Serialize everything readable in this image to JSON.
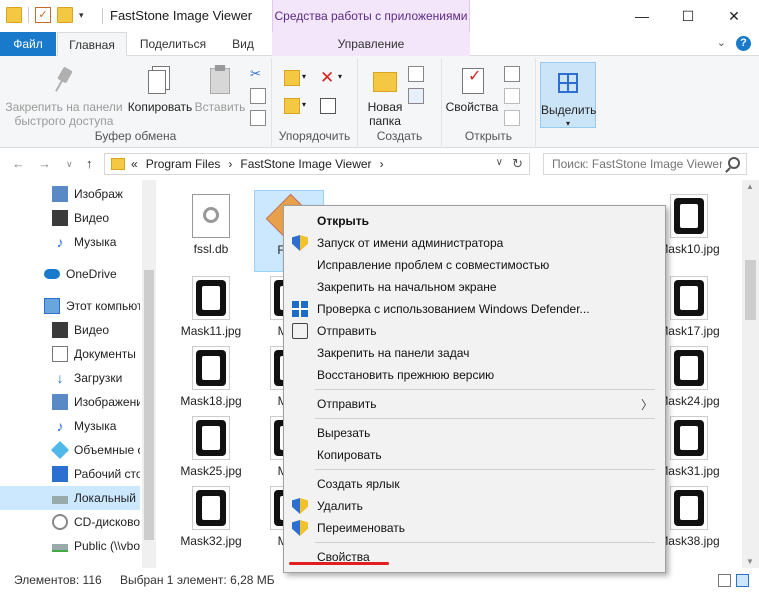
{
  "window": {
    "title": "FastStone Image Viewer",
    "context_tab_group": "Средства работы с приложениями",
    "minimize": "—",
    "maximize": "☐",
    "close": "✕"
  },
  "tabs": {
    "file": "Файл",
    "home": "Главная",
    "share": "Поделиться",
    "view": "Вид",
    "manage": "Управление",
    "collapse": "⌄"
  },
  "ribbon": {
    "clipboard": {
      "pin_label": "Закрепить на панели быстрого доступа",
      "copy_label": "Копировать",
      "paste_label": "Вставить",
      "group_label": "Буфер обмена"
    },
    "organize": {
      "group_label": "Упорядочить"
    },
    "new": {
      "new_folder_label": "Новая папка",
      "group_label": "Создать"
    },
    "open": {
      "properties_label": "Свойства",
      "group_label": "Открыть"
    },
    "select": {
      "select_label": "Выделить"
    }
  },
  "address": {
    "prefix": "«",
    "crumbs": [
      "Program Files",
      "›",
      "FastStone Image Viewer",
      "›"
    ],
    "search_placeholder": "Поиск: FastStone Image Viewer"
  },
  "nav": {
    "items": [
      {
        "label": "Изображ",
        "icon": "pictures-icon"
      },
      {
        "label": "Видео",
        "icon": "video-icon"
      },
      {
        "label": "Музыка",
        "icon": "music-icon"
      },
      {
        "label": "OneDrive",
        "icon": "onedrive-icon"
      },
      {
        "label": "Этот компьют",
        "icon": "this-pc-icon"
      },
      {
        "label": "Видео",
        "icon": "video-icon"
      },
      {
        "label": "Документы",
        "icon": "documents-icon"
      },
      {
        "label": "Загрузки",
        "icon": "downloads-icon"
      },
      {
        "label": "Изображени",
        "icon": "pictures-icon"
      },
      {
        "label": "Музыка",
        "icon": "music-icon"
      },
      {
        "label": "Объемные о",
        "icon": "3d-objects-icon"
      },
      {
        "label": "Рабочий сто",
        "icon": "desktop-icon"
      },
      {
        "label": "Локальный",
        "icon": "local-disk-icon"
      },
      {
        "label": "CD-дисково",
        "icon": "cd-drive-icon"
      },
      {
        "label": "Public (\\\\vbo",
        "icon": "network-drive-icon"
      }
    ]
  },
  "files": {
    "row1": [
      "fssl.db",
      "FSV",
      "",
      "",
      "",
      "",
      "Mask10.jpg"
    ],
    "row2": [
      "Mask11.jpg",
      "Mas",
      "Mask17.jpg"
    ],
    "row3": [
      "Mask18.jpg",
      "Mas",
      "Mask24.jpg"
    ],
    "row4": [
      "Mask25.jpg",
      "Mas",
      "Mask31.jpg"
    ],
    "row5": [
      "Mask32.jpg",
      "Mas",
      "Mask38.jpg"
    ]
  },
  "context_menu": {
    "items": [
      {
        "label": "Открыть",
        "bold": true,
        "icon": ""
      },
      {
        "label": "Запуск от имени администратора",
        "icon": "uac-shield-icon"
      },
      {
        "label": "Исправление проблем с совместимостью",
        "icon": ""
      },
      {
        "label": "Закрепить на начальном экране",
        "icon": ""
      },
      {
        "label": "Проверка с использованием Windows Defender...",
        "icon": "windows-defender-icon"
      },
      {
        "label": "Отправить",
        "icon": "share-icon"
      },
      {
        "label": "Закрепить на панели задач",
        "icon": ""
      },
      {
        "label": "Восстановить прежнюю версию",
        "icon": ""
      },
      {
        "label": "Отправить",
        "icon": "",
        "submenu": true
      },
      {
        "label": "Вырезать",
        "icon": ""
      },
      {
        "label": "Копировать",
        "icon": ""
      },
      {
        "label": "Создать ярлык",
        "icon": ""
      },
      {
        "label": "Удалить",
        "icon": "uac-shield-icon"
      },
      {
        "label": "Переименовать",
        "icon": "uac-shield-icon"
      },
      {
        "label": "Свойства",
        "icon": ""
      }
    ]
  },
  "status": {
    "count": "Элементов: 116",
    "selection": "Выбран 1 элемент: 6,28 МБ"
  },
  "colors": {
    "accent": "#1979ca",
    "context_tab": "#f3e5fa",
    "highlight_underline": "#e02020",
    "selection": "#cce8ff"
  }
}
